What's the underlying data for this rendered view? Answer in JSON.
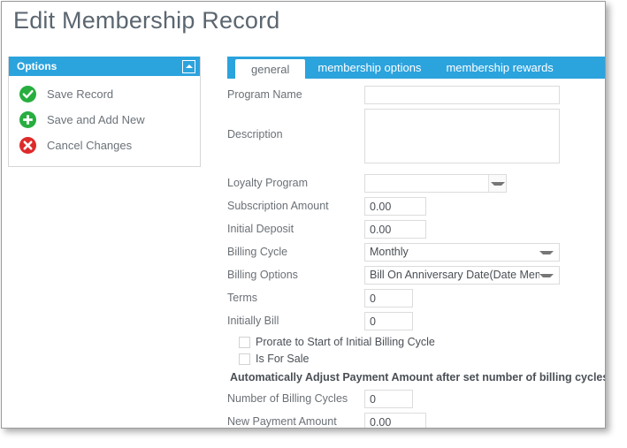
{
  "page_title": "Edit Membership Record",
  "colors": {
    "accent_blue": "#2ba3dd",
    "title_gray": "#5b6670",
    "label_gray": "#6b7076",
    "success_green": "#27ae3f",
    "danger_red": "#de2a2a"
  },
  "options_panel": {
    "header_title": "Options",
    "collapse_icon": "chevron-up-icon",
    "items": [
      {
        "label": "Save Record",
        "icon": "check-circle-icon",
        "color": "#27ae3f"
      },
      {
        "label": "Save and Add New",
        "icon": "plus-circle-icon",
        "color": "#27ae3f"
      },
      {
        "label": "Cancel Changes",
        "icon": "x-circle-icon",
        "color": "#de2a2a"
      }
    ]
  },
  "tabs": [
    {
      "label": "general",
      "active": true
    },
    {
      "label": "membership options",
      "active": false
    },
    {
      "label": "membership rewards",
      "active": false
    }
  ],
  "form": {
    "program_name": {
      "label": "Program Name",
      "value": "",
      "placeholder": ""
    },
    "description": {
      "label": "Description",
      "value": "",
      "placeholder": ""
    },
    "loyalty_program": {
      "label": "Loyalty Program",
      "value": "",
      "icon": "chevron-down-icon"
    },
    "subscription_amount": {
      "label": "Subscription Amount",
      "value": "0.00"
    },
    "initial_deposit": {
      "label": "Initial Deposit",
      "value": "0.00"
    },
    "billing_cycle": {
      "label": "Billing Cycle",
      "value": "Monthly",
      "icon": "chevron-down-icon"
    },
    "billing_options": {
      "label": "Billing Options",
      "value": "Bill On Anniversary Date(Date Memb",
      "icon": "chevron-down-icon"
    },
    "terms": {
      "label": "Terms",
      "value": "0"
    },
    "initially_bill": {
      "label": "Initially Bill",
      "value": "0"
    },
    "prorate": {
      "label": "Prorate to Start of Initial Billing Cycle",
      "checked": false
    },
    "is_for_sale": {
      "label": "Is For Sale",
      "checked": false
    },
    "auto_adjust_heading": "Automatically Adjust Payment Amount after set number of billing cycles",
    "number_of_billing_cycles": {
      "label": "Number of Billing Cycles",
      "value": "0"
    },
    "new_payment_amount": {
      "label": "New Payment Amount",
      "value": "0.00"
    }
  }
}
